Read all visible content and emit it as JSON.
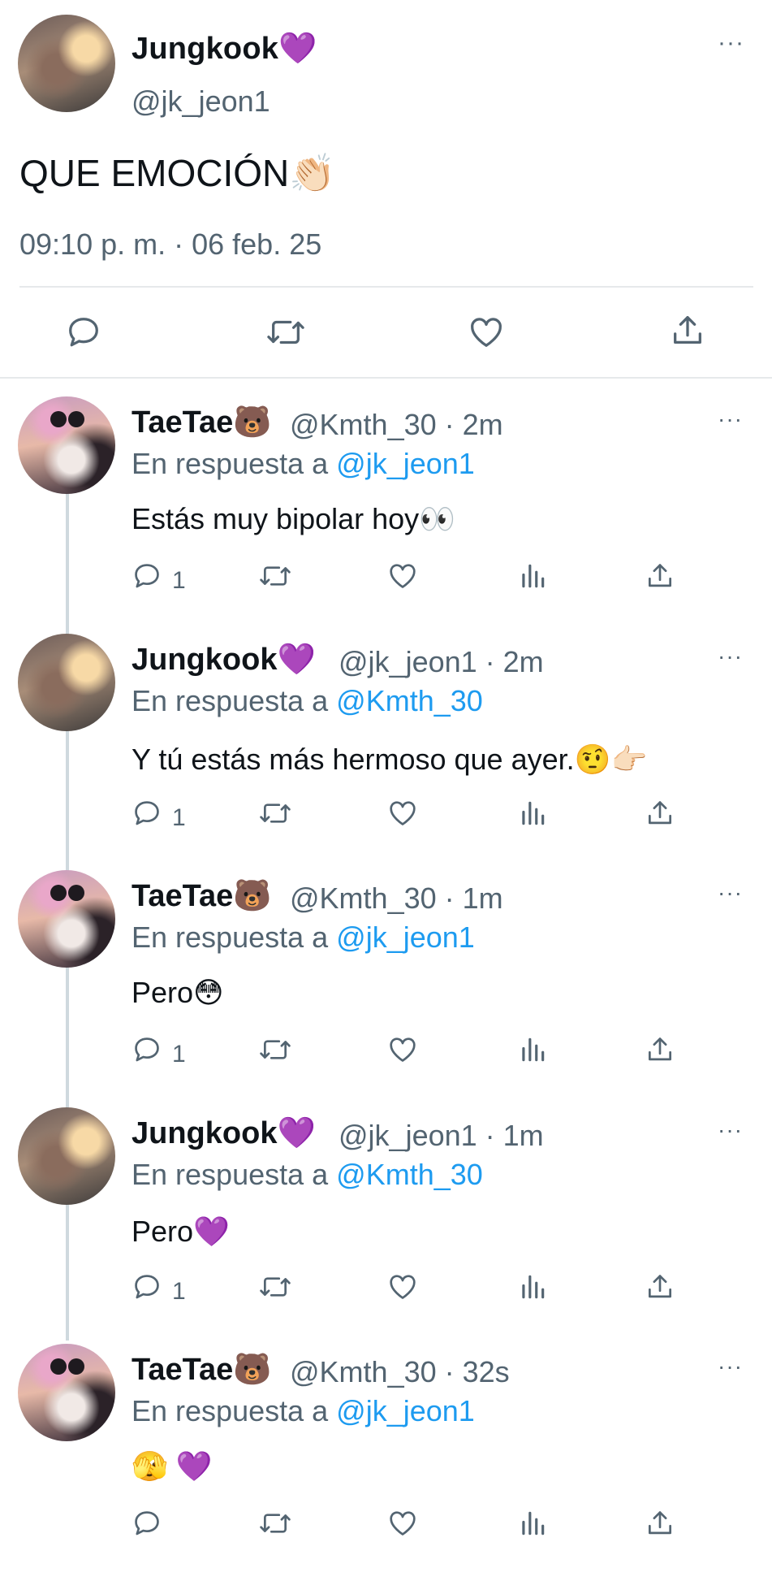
{
  "main_tweet": {
    "name": "Jungkook💜",
    "handle": "@jk_jeon1",
    "text": "QUE EMOCIÓN👏🏻",
    "timestamp": "09:10 p. m. · 06 feb. 25",
    "more": "···"
  },
  "replies": [
    {
      "name": "TaeTae🐻",
      "meta": "@Kmth_30 · 2m",
      "reply_prefix": "En respuesta a ",
      "reply_to": "@jk_jeon1",
      "text": "Estás muy bipolar hoy👀",
      "reply_count": "1",
      "more": "···"
    },
    {
      "name": "Jungkook💜",
      "meta": "@jk_jeon1 · 2m",
      "reply_prefix": "En respuesta a ",
      "reply_to": "@Kmth_30",
      "text": "Y tú estás más hermoso que ayer.🤨👉🏻",
      "reply_count": "1",
      "more": "···"
    },
    {
      "name": "TaeTae🐻",
      "meta": "@Kmth_30 · 1m",
      "reply_prefix": "En respuesta a ",
      "reply_to": "@jk_jeon1",
      "text": "Pero😳",
      "reply_count": "1",
      "more": "···"
    },
    {
      "name": "Jungkook💜",
      "meta": "@jk_jeon1 · 1m",
      "reply_prefix": "En respuesta a ",
      "reply_to": "@Kmth_30",
      "text": "Pero💜",
      "reply_count": "1",
      "more": "···"
    },
    {
      "name": "TaeTae🐻",
      "meta": "@Kmth_30 · 32s",
      "reply_prefix": "En respuesta a ",
      "reply_to": "@jk_jeon1",
      "text": "🫣 💜",
      "reply_count": "",
      "more": "···"
    }
  ],
  "icons": {
    "reply": "reply-icon",
    "retweet": "retweet-icon",
    "like": "heart-icon",
    "views": "views-icon",
    "share": "share-icon",
    "more": "more-icon"
  },
  "colors": {
    "text": "#0f1419",
    "secondary": "#536471",
    "mention": "#1d9bf0",
    "divider": "#e6e9eb"
  }
}
